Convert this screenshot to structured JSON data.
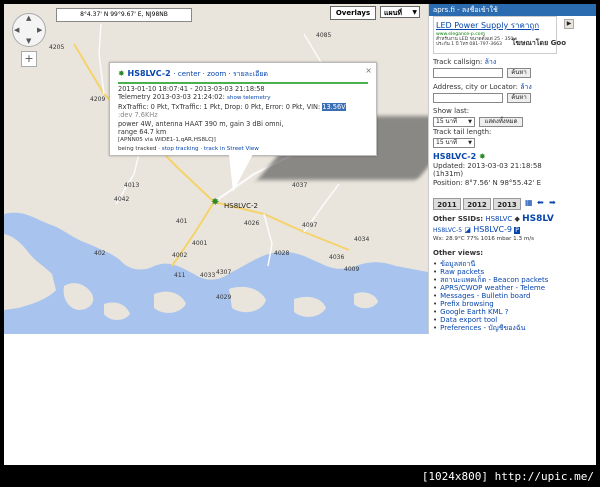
{
  "coords": "8°4.37' N 99°9.67' E, NJ98NB",
  "overlays_label": "Overlays",
  "maptype": "แผนที่",
  "map_labels": [
    "4205",
    "4013",
    "4037",
    "4097",
    "401",
    "4042",
    "4307",
    "4002",
    "402",
    "4028",
    "4026",
    "411",
    "4001",
    "4033",
    "4029",
    "4209",
    "4085",
    "4009",
    "4034",
    "4036"
  ],
  "marker_label": "HS8LVC-2",
  "popup": {
    "callsign": "HS8LVC-2",
    "link_center": "center",
    "link_zoom": "zoom",
    "link_info": "รายละเอียด",
    "dates": "2013-01-10 18:07:41 - 2013-03-03 21:18:58",
    "telemetry_label": "Telemetry 2013-03-03 21:24:02:",
    "show_telemetry": "show telemetry",
    "traffic": "RxTraffic: 0 Pkt, TxTraffic: 1 Pkt, Drop: 0 Pkt, Error: 0 Pkt, VIN:",
    "vin_value": "13.56V",
    "dev": ":dev 7.6KHz",
    "power": "power 4W, antenna HAAT 390 m, gain 3 dBi omni,",
    "range": "range 64.7 km",
    "path": "[APNN05 via WIDE1-1,qAR,HS8LCJ]",
    "being_tracked": "being tracked",
    "stop_tracking": "stop tracking",
    "street_view": "track in Street View",
    "close": "×"
  },
  "panel": {
    "top": "aprs.fi - ลงชื่อเข้าใช้",
    "ad_title": "LED Power Supply ราคาถูก",
    "ad_url": "www.elegance-p.com",
    "ad_desc1": "สำหรับงาน LED ขนาดตั้งแต่ 25 - 350w",
    "ad_desc2": "ประกัน 1 ปี โทร 081-797-3663",
    "ad_google": "โฆษณาโดย Goo",
    "track_callsign": "Track callsign:",
    "track_callsign_link": "ล้าง",
    "btn_track": "ค้นหา",
    "address_label": "Address, city or Locator:",
    "address_link": "ล้าง",
    "btn_search": "ค้นหา",
    "show_last": "Show last:",
    "show_last_value": "15 นาที",
    "btn_refresh": "แสดงทั้งหมด",
    "tail_label": "Track tail length:",
    "tail_value": "15 นาที",
    "station": "HS8LVC-2",
    "updated": "Updated: 2013-03-03 21:18:58",
    "ago": "(1h31m)",
    "position": "Position: 8°7.56' N 98°55.42' E",
    "years": [
      "2011",
      "2012",
      "2013"
    ],
    "other_ssids_label": "Other SSIDs:",
    "ssid1": "HS8LVC",
    "ssid2": "HS8LV",
    "ssid3": "HS8LVC-5",
    "ssid4": "HS8LVC-9",
    "wx": "Wx: 28.9°C 77% 1016 mbar 1.3 m/s",
    "other_views": "Other views:",
    "views": [
      "ข้อมูลสถานี",
      "Raw packets",
      "สถานะแพคเก็ต - Beacon packets",
      "APRS/CWOP weather - Teleme",
      "Messages - Bulletin board",
      "Prefix browsing",
      "Google Earth KML ?",
      "Data export tool",
      "Preferences - บัญชีของฉัน"
    ]
  },
  "footer": "[1024x800] http://upic.me/"
}
